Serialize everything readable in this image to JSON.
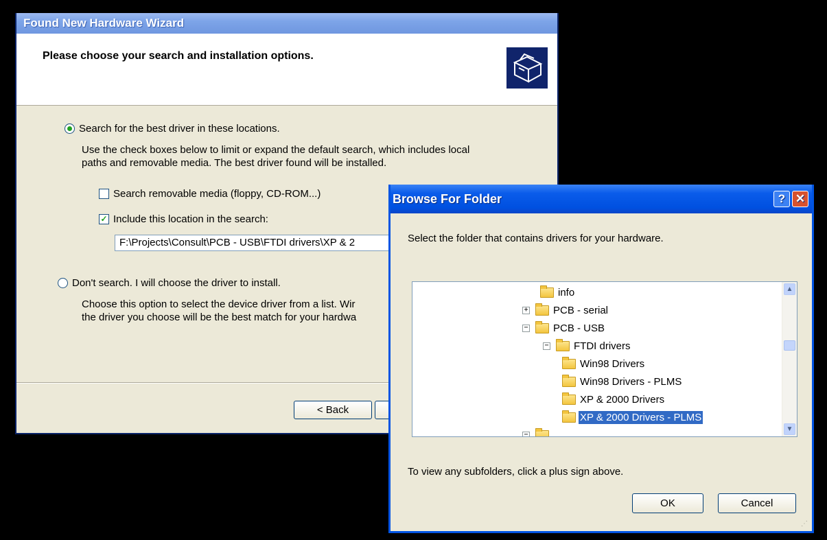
{
  "wizard": {
    "title": "Found New Hardware Wizard",
    "heading": "Please choose your search and installation options.",
    "option_search": {
      "label": "Search for the best driver in these locations.",
      "selected": true,
      "description_line1": "Use the check boxes below to limit or expand the default search, which includes local",
      "description_line2": "paths and removable media. The best driver found will be installed."
    },
    "check_removable": {
      "label": "Search removable media (floppy, CD-ROM...)",
      "checked": false
    },
    "check_location": {
      "label": "Include this location in the search:",
      "checked": true
    },
    "location_value": "F:\\Projects\\Consult\\PCB - USB\\FTDI drivers\\XP & 2",
    "option_dont_search": {
      "label": "Don't search. I will choose the driver to install.",
      "selected": false,
      "description_line1": "Choose this option to select the device driver from a list.  Wir",
      "description_line2": "the driver you choose will be the best match for your hardwa"
    },
    "back_label": "< Back"
  },
  "browse": {
    "title": "Browse For Folder",
    "description": "Select the folder that contains drivers for your hardware.",
    "tree": [
      {
        "label": "info",
        "expander": "",
        "selected": false
      },
      {
        "label": "PCB - serial",
        "expander": "+",
        "selected": false
      },
      {
        "label": "PCB - USB",
        "expander": "−",
        "selected": false
      },
      {
        "label": "FTDI drivers",
        "expander": "−",
        "selected": false
      },
      {
        "label": "Win98 Drivers",
        "expander": "",
        "selected": false
      },
      {
        "label": "Win98 Drivers - PLMS",
        "expander": "",
        "selected": false
      },
      {
        "label": "XP & 2000 Drivers",
        "expander": "",
        "selected": false
      },
      {
        "label": "XP & 2000 Drivers - PLMS",
        "expander": "",
        "selected": true
      }
    ],
    "hint": "To view any subfolders, click a plus sign above.",
    "ok_label": "OK",
    "cancel_label": "Cancel"
  },
  "icons": {
    "help": "help-icon",
    "close": "close-icon",
    "folder": "folder-icon",
    "hardware": "hardware-box-icon"
  },
  "colors": {
    "selection": "#316ac5",
    "titlebar_active": "#0054e3",
    "titlebar_inactive": "#7da4e8",
    "window_bg": "#ece9d8"
  }
}
